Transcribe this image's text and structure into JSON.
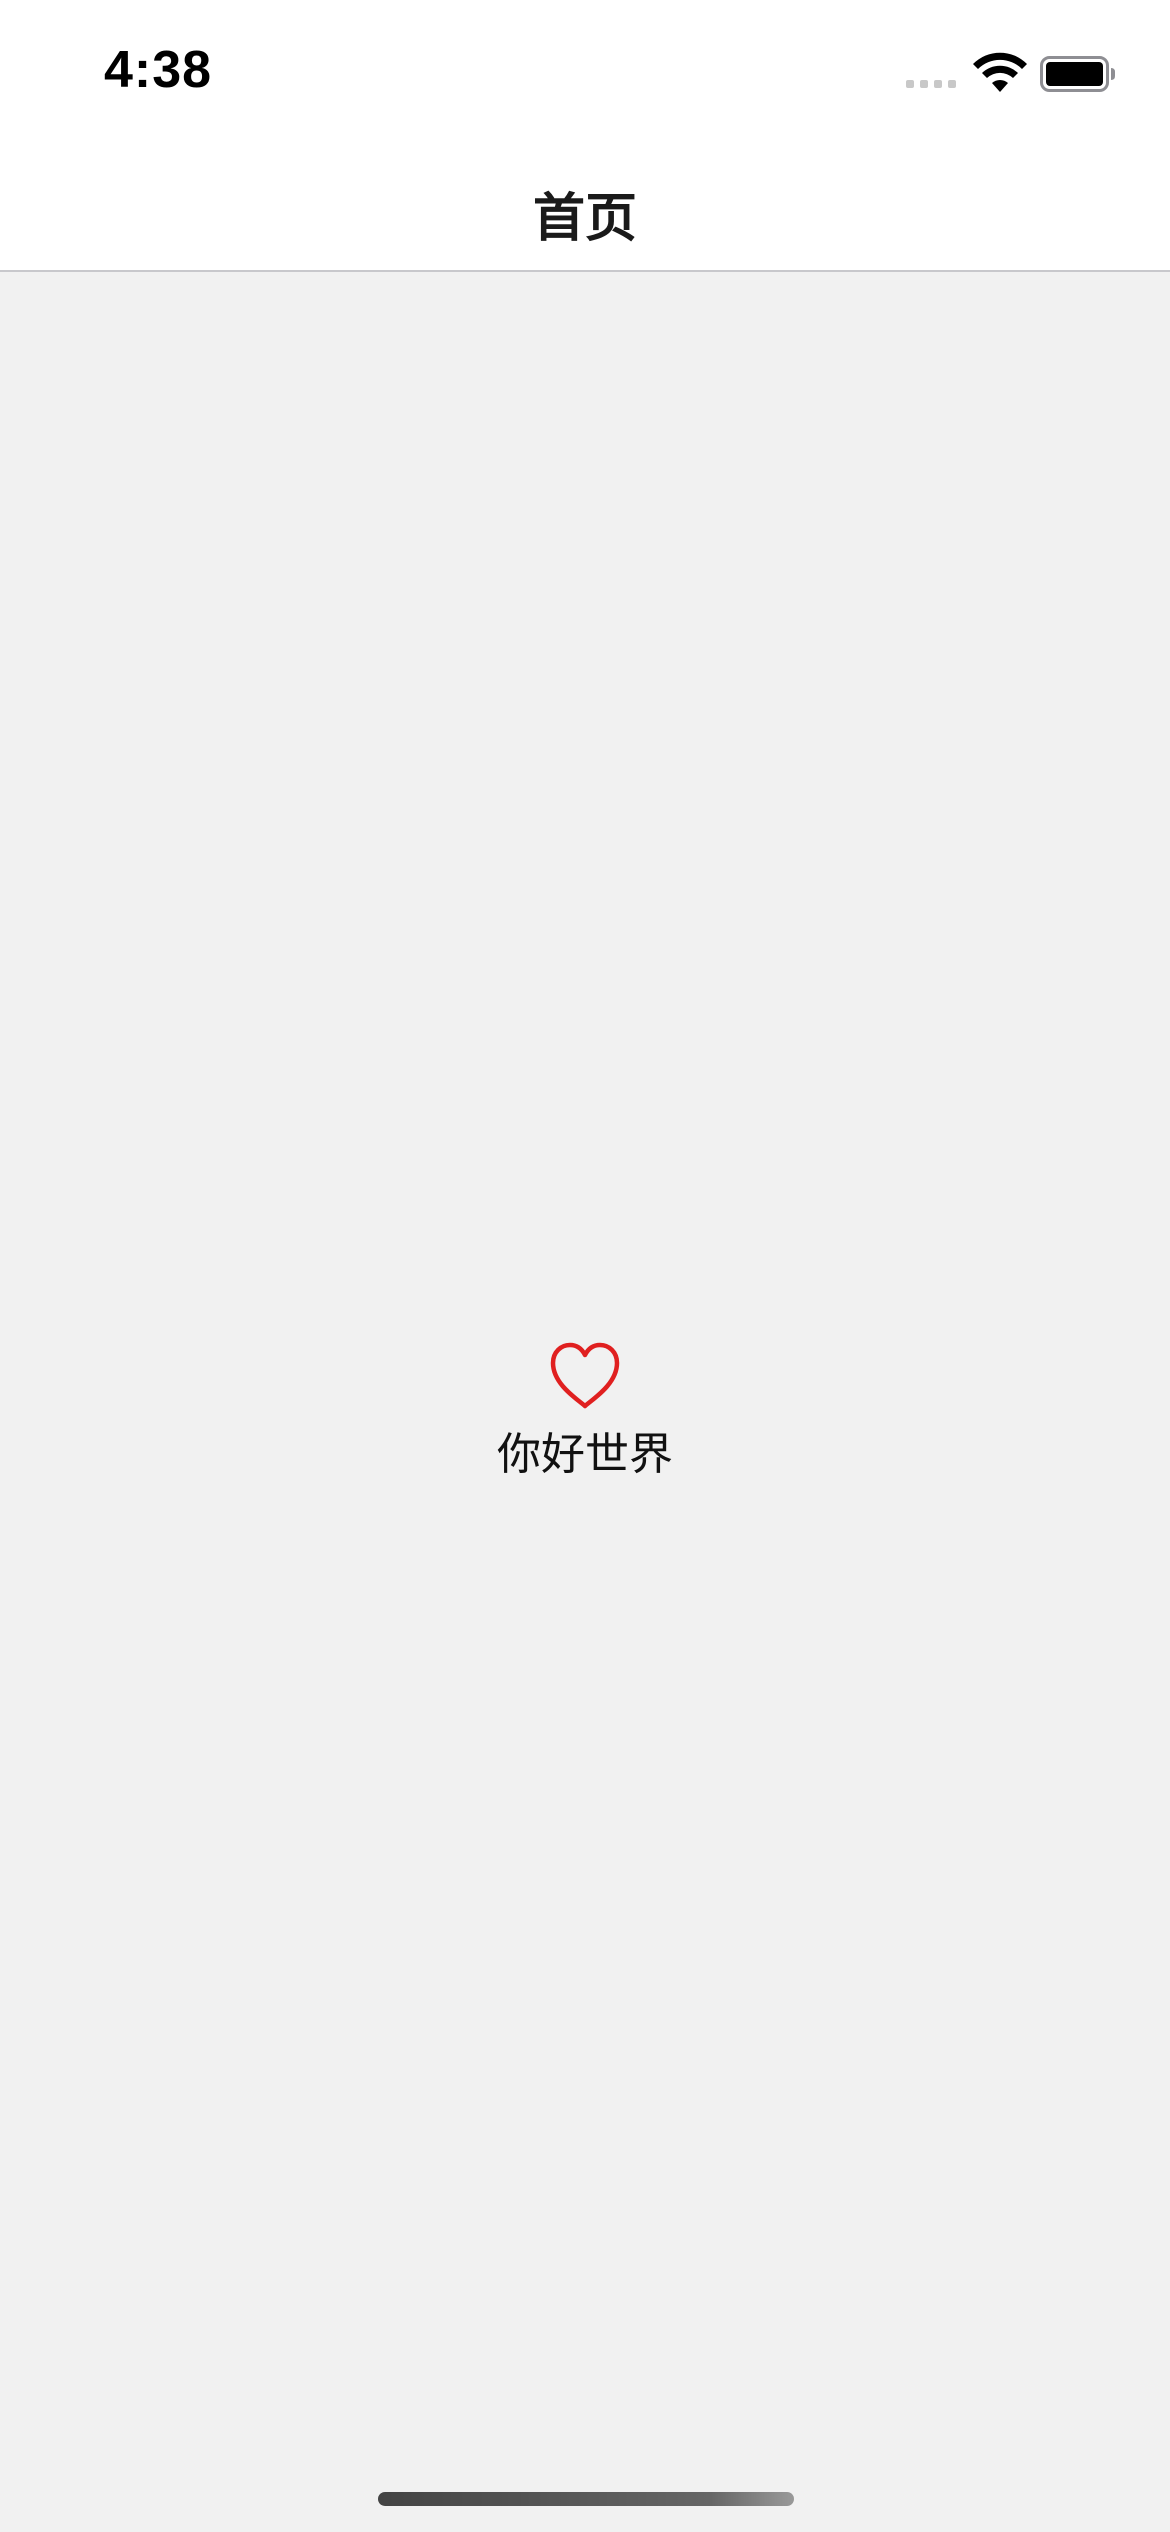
{
  "status_bar": {
    "time": "4:38",
    "signal_icon": "cellular-signal-icon",
    "wifi_icon": "wifi-icon",
    "battery_icon": "battery-icon",
    "battery_level": 1.0
  },
  "nav_bar": {
    "title": "首页"
  },
  "content": {
    "heart_icon": "heart-outline-icon",
    "heart_color": "#e02020",
    "text": "你好世界"
  },
  "colors": {
    "background": "#f1f1f1",
    "bar_background": "#ffffff"
  }
}
